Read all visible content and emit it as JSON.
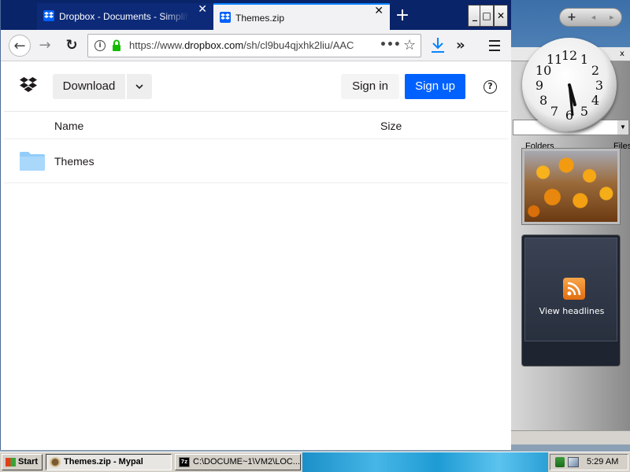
{
  "browser": {
    "tabs": [
      {
        "title": "Dropbox - Documents - Simplify your",
        "close": "✕",
        "active": false
      },
      {
        "title": "Themes.zip",
        "close": "✕",
        "active": true
      }
    ],
    "new_tab": "+",
    "window_controls": {
      "minimize": "_",
      "maximize": "□",
      "close": "✕"
    },
    "nav": {
      "back": "←",
      "forward": "→",
      "reload": "↻"
    },
    "url": {
      "scheme": "https://www.",
      "host": "dropbox.com",
      "path": "/sh/cl9bu4qjxhk2liu/AAC"
    },
    "page_actions": "•••",
    "star_icon": "☆",
    "overflow": "»"
  },
  "page": {
    "download_label": "Download",
    "download_chevron": "⌄",
    "signin_label": "Sign in",
    "signup_label": "Sign up",
    "help": "?",
    "columns": {
      "name": "Name",
      "size": "Size"
    },
    "files": [
      {
        "name": "Themes",
        "size": "",
        "type": "folder"
      }
    ],
    "colors": {
      "brand_blue": "#0061fe",
      "folder_blue": "#92cdf9"
    }
  },
  "desktop": {
    "gadget_controls": {
      "add": "+",
      "nav": "◄ ►"
    },
    "clock": {
      "hour": 5,
      "minute": 29,
      "numerals": [
        "12",
        "1",
        "2",
        "3",
        "4",
        "5",
        "6",
        "7",
        "8",
        "9",
        "10",
        "11"
      ]
    },
    "rss_label": "View headlines",
    "background_window": {
      "close": "x",
      "tab_left": "Folders",
      "tab_right": "Files"
    }
  },
  "taskbar": {
    "start_label": "Start",
    "tasks": [
      {
        "label": "Themes.zip - Mypal",
        "active": true
      },
      {
        "label": "C:\\DOCUME~1\\VM2\\LOC...",
        "icon_text": "7z",
        "active": false
      }
    ],
    "time": "5:29 AM"
  }
}
